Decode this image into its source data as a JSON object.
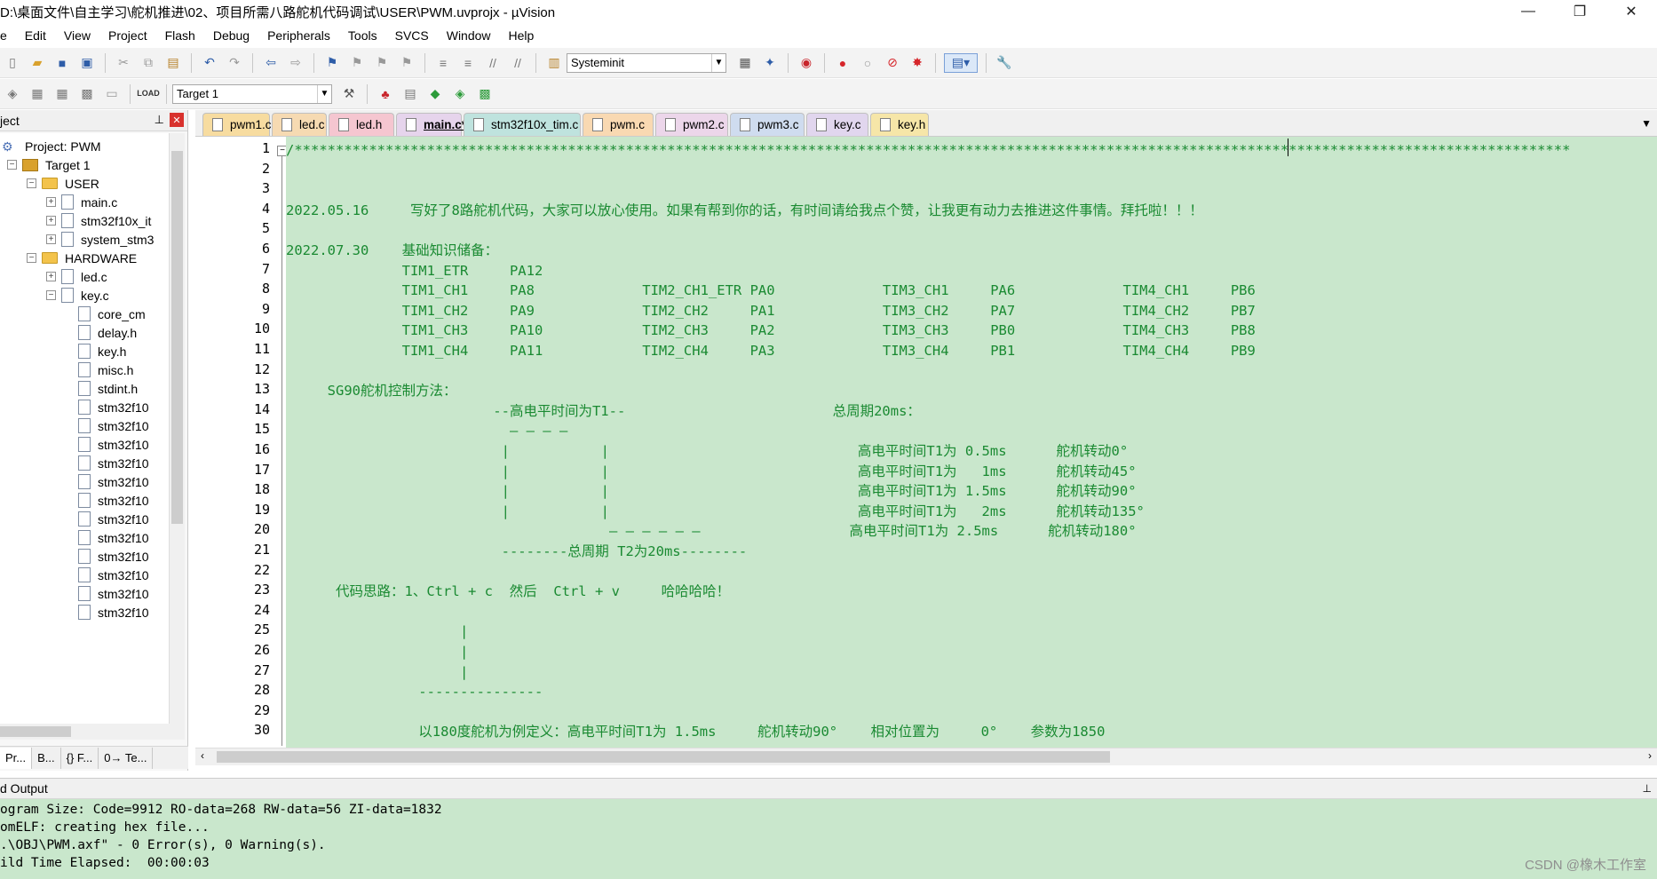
{
  "window": {
    "title": "D:\\桌面文件\\自主学习\\舵机推进\\02、项目所需八路舵机代码调试\\USER\\PWM.uvprojx - µVision",
    "minimize": "—",
    "restore": "❐",
    "close": "✕"
  },
  "menu": [
    "e",
    "Edit",
    "View",
    "Project",
    "Flash",
    "Debug",
    "Peripherals",
    "Tools",
    "SVCS",
    "Window",
    "Help"
  ],
  "toolbar": {
    "function_combo": "Systeminit",
    "target_combo": "Target 1",
    "load_label": "LOAD"
  },
  "project": {
    "header": "ject",
    "pin": "⊥",
    "close": "✕",
    "tree": [
      {
        "label": "Project: PWM",
        "kind": "project",
        "level": 0,
        "exp": ""
      },
      {
        "label": "Target 1",
        "kind": "target",
        "level": 1,
        "exp": "−"
      },
      {
        "label": "USER",
        "kind": "folder",
        "level": 2,
        "exp": "−"
      },
      {
        "label": "main.c",
        "kind": "file",
        "level": 3,
        "exp": "+"
      },
      {
        "label": "stm32f10x_it",
        "kind": "file",
        "level": 3,
        "exp": "+"
      },
      {
        "label": "system_stm3",
        "kind": "file",
        "level": 3,
        "exp": "+"
      },
      {
        "label": "HARDWARE",
        "kind": "folder",
        "level": 2,
        "exp": "−"
      },
      {
        "label": "led.c",
        "kind": "file",
        "level": 3,
        "exp": "+"
      },
      {
        "label": "key.c",
        "kind": "file",
        "level": 3,
        "exp": "−"
      },
      {
        "label": "core_cm",
        "kind": "file",
        "level": 4,
        "exp": ""
      },
      {
        "label": "delay.h",
        "kind": "file",
        "level": 4,
        "exp": ""
      },
      {
        "label": "key.h",
        "kind": "file",
        "level": 4,
        "exp": ""
      },
      {
        "label": "misc.h",
        "kind": "file",
        "level": 4,
        "exp": ""
      },
      {
        "label": "stdint.h",
        "kind": "file",
        "level": 4,
        "exp": ""
      },
      {
        "label": "stm32f10",
        "kind": "file",
        "level": 4,
        "exp": ""
      },
      {
        "label": "stm32f10",
        "kind": "file",
        "level": 4,
        "exp": ""
      },
      {
        "label": "stm32f10",
        "kind": "file",
        "level": 4,
        "exp": ""
      },
      {
        "label": "stm32f10",
        "kind": "file",
        "level": 4,
        "exp": ""
      },
      {
        "label": "stm32f10",
        "kind": "file",
        "level": 4,
        "exp": ""
      },
      {
        "label": "stm32f10",
        "kind": "file",
        "level": 4,
        "exp": ""
      },
      {
        "label": "stm32f10",
        "kind": "file",
        "level": 4,
        "exp": ""
      },
      {
        "label": "stm32f10",
        "kind": "file",
        "level": 4,
        "exp": ""
      },
      {
        "label": "stm32f10",
        "kind": "file",
        "level": 4,
        "exp": ""
      },
      {
        "label": "stm32f10",
        "kind": "file",
        "level": 4,
        "exp": ""
      },
      {
        "label": "stm32f10",
        "kind": "file",
        "level": 4,
        "exp": ""
      },
      {
        "label": "stm32f10",
        "kind": "file",
        "level": 4,
        "exp": ""
      }
    ],
    "tabs": [
      "Pr...",
      "B...",
      "{} F...",
      "0→ Te..."
    ]
  },
  "editor": {
    "tabs": [
      {
        "label": "pwm1.c",
        "color": "#f7dca0",
        "active": false
      },
      {
        "label": "led.c",
        "color": "#f6dab2",
        "active": false
      },
      {
        "label": "led.h",
        "color": "#f5c6d0",
        "active": false
      },
      {
        "label": "main.c*",
        "color": "#e6d4ec",
        "active": true
      },
      {
        "label": "stm32f10x_tim.c",
        "color": "#bfe3de",
        "active": false
      },
      {
        "label": "pwm.c",
        "color": "#f9d9b2",
        "active": false
      },
      {
        "label": "pwm2.c",
        "color": "#ecd6ea",
        "active": false
      },
      {
        "label": "pwm3.c",
        "color": "#cfdcef",
        "active": false
      },
      {
        "label": "key.c",
        "color": "#e1d6ee",
        "active": false
      },
      {
        "label": "key.h",
        "color": "#f6e6a8",
        "active": false
      }
    ],
    "fold_marker": "−",
    "lines": [
      "/**********************************************************************************************************************************************************",
      "",
      "",
      "2022.05.16     写好了8路舵机代码，大家可以放心使用。如果有帮到你的话，有时间请给我点个赞，让我更有动力去推进这件事情。拜托啦！！！",
      "",
      "2022.07.30    基础知识储备：",
      "              TIM1_ETR     PA12",
      "              TIM1_CH1     PA8             TIM2_CH1_ETR PA0             TIM3_CH1     PA6             TIM4_CH1     PB6",
      "              TIM1_CH2     PA9             TIM2_CH2     PA1             TIM3_CH2     PA7             TIM4_CH2     PB7",
      "              TIM1_CH3     PA10            TIM2_CH3     PA2             TIM3_CH3     PB0             TIM4_CH3     PB8",
      "              TIM1_CH4     PA11            TIM2_CH4     PA3             TIM3_CH4     PB1             TIM4_CH4     PB9",
      "",
      "     SG90舵机控制方法：",
      "                         --高电平时间为T1--                         总周期20ms：",
      "                           — — — —",
      "                          |           |                              高电平时间T1为 0.5ms      舵机转动0°",
      "                          |           |                              高电平时间T1为   1ms      舵机转动45°",
      "                          |           |                              高电平时间T1为 1.5ms      舵机转动90°",
      "                          |           |                              高电平时间T1为   2ms      舵机转动135°",
      "                                       — — — — — —                  高电平时间T1为 2.5ms      舵机转动180°",
      "                          --------总周期 T2为20ms--------",
      "",
      "      代码思路：1、Ctrl + c  然后  Ctrl + v     哈哈哈哈！",
      "",
      "                     |",
      "                     |",
      "                     |",
      "                ---------------",
      "",
      "                以180度舵机为例定义：高电平时间T1为 1.5ms     舵机转动90°    相对位置为     0°    参数为1850"
    ]
  },
  "output": {
    "header": "d Output",
    "pin": "⊥",
    "lines": [
      "ogram Size: Code=9912 RO-data=268 RW-data=56 ZI-data=1832",
      "omELF: creating hex file...",
      ".\\OBJ\\PWM.axf\" - 0 Error(s), 0 Warning(s).",
      "ild Time Elapsed:  00:00:03"
    ]
  },
  "watermark": "CSDN @橡木工作室"
}
